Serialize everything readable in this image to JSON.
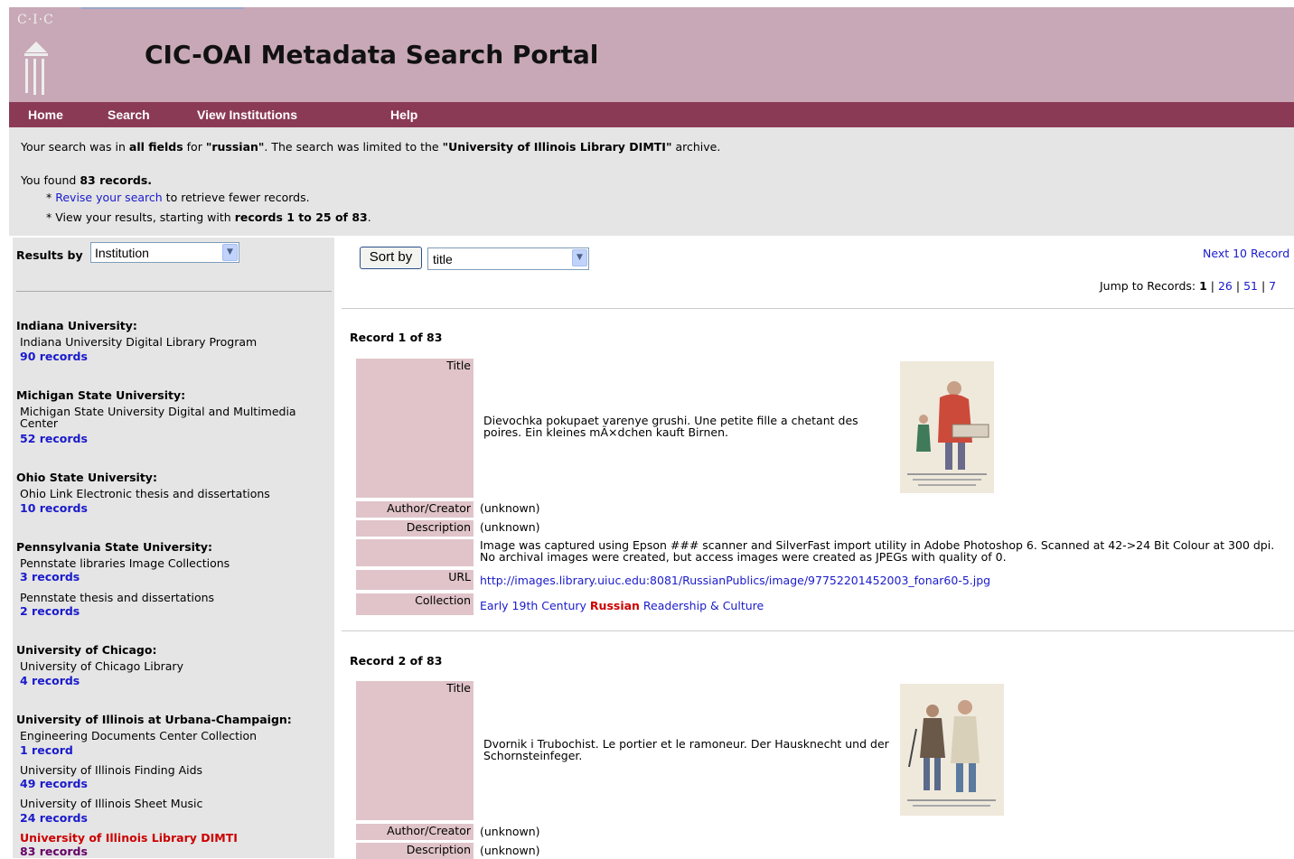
{
  "header": {
    "logo_text": "C·I·C",
    "title": "CIC-OAI Metadata Search Portal"
  },
  "nav": [
    "Home",
    "Search",
    "View Institutions",
    "Help"
  ],
  "summary": {
    "l1_a": "Your search was in ",
    "l1_b": "all fields",
    "l1_c": " for ",
    "l1_d": "\"russian\"",
    "l1_e": ".  The search was limited to the ",
    "l1_f": "\"University of Illinois Library DIMTI\"",
    "l1_g": " archive.",
    "l2_a": "You found ",
    "l2_b": "83 records.",
    "l3_star": "* ",
    "l3_link": "Revise your search",
    "l3_rest": " to retrieve fewer records.",
    "l4_a": "* View your results, starting with ",
    "l4_b": "records 1 to 25 of 83",
    "l4_c": "."
  },
  "sidebar": {
    "results_by": "Results by",
    "select_value": "Institution",
    "institutions": [
      {
        "name": "Indiana University:",
        "collections": [
          {
            "label": "Indiana University Digital Library Program",
            "count": "90 records"
          }
        ]
      },
      {
        "name": "Michigan State University:",
        "collections": [
          {
            "label": "Michigan State University Digital and Multimedia Center",
            "count": "52 records"
          }
        ]
      },
      {
        "name": "Ohio State University:",
        "collections": [
          {
            "label": "Ohio Link Electronic thesis and dissertations",
            "count": "10 records"
          }
        ]
      },
      {
        "name": "Pennsylvania State University:",
        "collections": [
          {
            "label": "Pennstate libraries Image Collections",
            "count": "3 records"
          },
          {
            "label": "Pennstate thesis and dissertations",
            "count": "2 records"
          }
        ]
      },
      {
        "name": "University of Chicago:",
        "collections": [
          {
            "label": "University of Chicago Library",
            "count": "4 records"
          }
        ]
      },
      {
        "name": "University of Illinois at Urbana-Champaign:",
        "collections": [
          {
            "label": "Engineering Documents Center Collection",
            "count": "1 record"
          },
          {
            "label": "University of Illinois Finding Aids",
            "count": "49 records"
          },
          {
            "label": "University of Illinois Sheet Music",
            "count": "24 records"
          },
          {
            "label": "University of Illinois Library DIMTI",
            "count": "83 records"
          }
        ]
      }
    ]
  },
  "main": {
    "sort_button": "Sort by",
    "sort_value": "title",
    "next_link": "Next 10 Record",
    "jump_label": "Jump to Records: ",
    "jump_current": "1",
    "jump_sep": " | ",
    "jump_links": [
      "26",
      "51",
      "7"
    ],
    "records": [
      {
        "heading": "Record 1 of 83",
        "labels": {
          "title": "Title",
          "author": "Author/Creator",
          "description": "Description",
          "url": "URL",
          "collection": "Collection"
        },
        "title": "Dievochka pokupaet varenye grushi. Une petite fille a chetant des poires. Ein kleines mÃ×dchen kauft Birnen.",
        "author": "(unknown)",
        "description": "(unknown)",
        "description2": "Image was captured using Epson ### scanner and SilverFast import utility in Adobe Photoshop 6. Scanned at 42->24 Bit Colour at 300 dpi. No archival images were created, but access images were created as JPEGs with quality of 0.",
        "url": "http://images.library.uiuc.edu:8081/RussianPublics/image/97752201452003_fonar60-5.jpg",
        "collection_a": "Early 19th Century ",
        "collection_b": "Russian",
        "collection_c": " Readership & Culture"
      },
      {
        "heading": "Record 2 of 83",
        "labels": {
          "title": "Title",
          "author": "Author/Creator",
          "description": "Description"
        },
        "title": "Dvornik i Trubochist. Le portier et le ramoneur. Der Hausknecht und der Schornsteinfeger.",
        "author": "(unknown)",
        "description": "(unknown)"
      }
    ]
  }
}
